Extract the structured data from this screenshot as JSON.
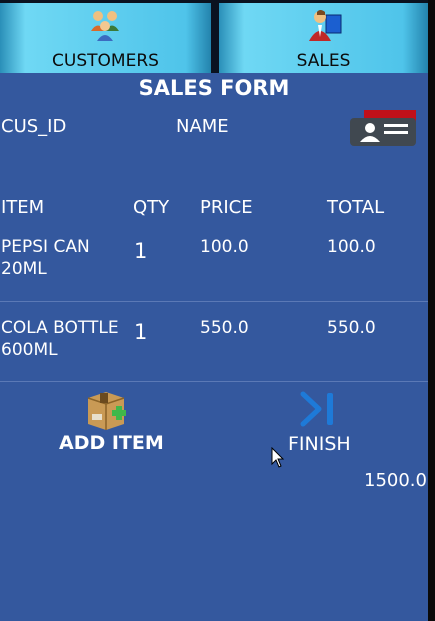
{
  "tabs": [
    {
      "label": "CUSTOMERS",
      "icon": "customers-icon"
    },
    {
      "label": "SALES",
      "icon": "sales-person-icon"
    }
  ],
  "form": {
    "title": "SALES FORM",
    "cus_id_label": "CUS_ID",
    "name_label": "NAME",
    "card_icon": "customer-card-icon"
  },
  "table": {
    "headers": [
      "ITEM",
      "QTY",
      "PRICE",
      "TOTAL"
    ],
    "rows": [
      {
        "item_line1": "PEPSI CAN",
        "item_line2": "20ML",
        "qty": "1",
        "price": "100.0",
        "total": "100.0"
      },
      {
        "item_line1": "COLA BOTTLE",
        "item_line2": "600ML",
        "qty": "1",
        "price": "550.0",
        "total": "550.0"
      }
    ]
  },
  "actions": {
    "add_item_label": "ADD ITEM",
    "add_item_icon": "box-add-icon",
    "finish_label": "FINISH",
    "finish_icon": "skip-end-icon"
  },
  "grand_total": "1500.0",
  "colors": {
    "background": "#34589e",
    "tab": "#4fc4ea",
    "divider": "#5b79b6"
  }
}
